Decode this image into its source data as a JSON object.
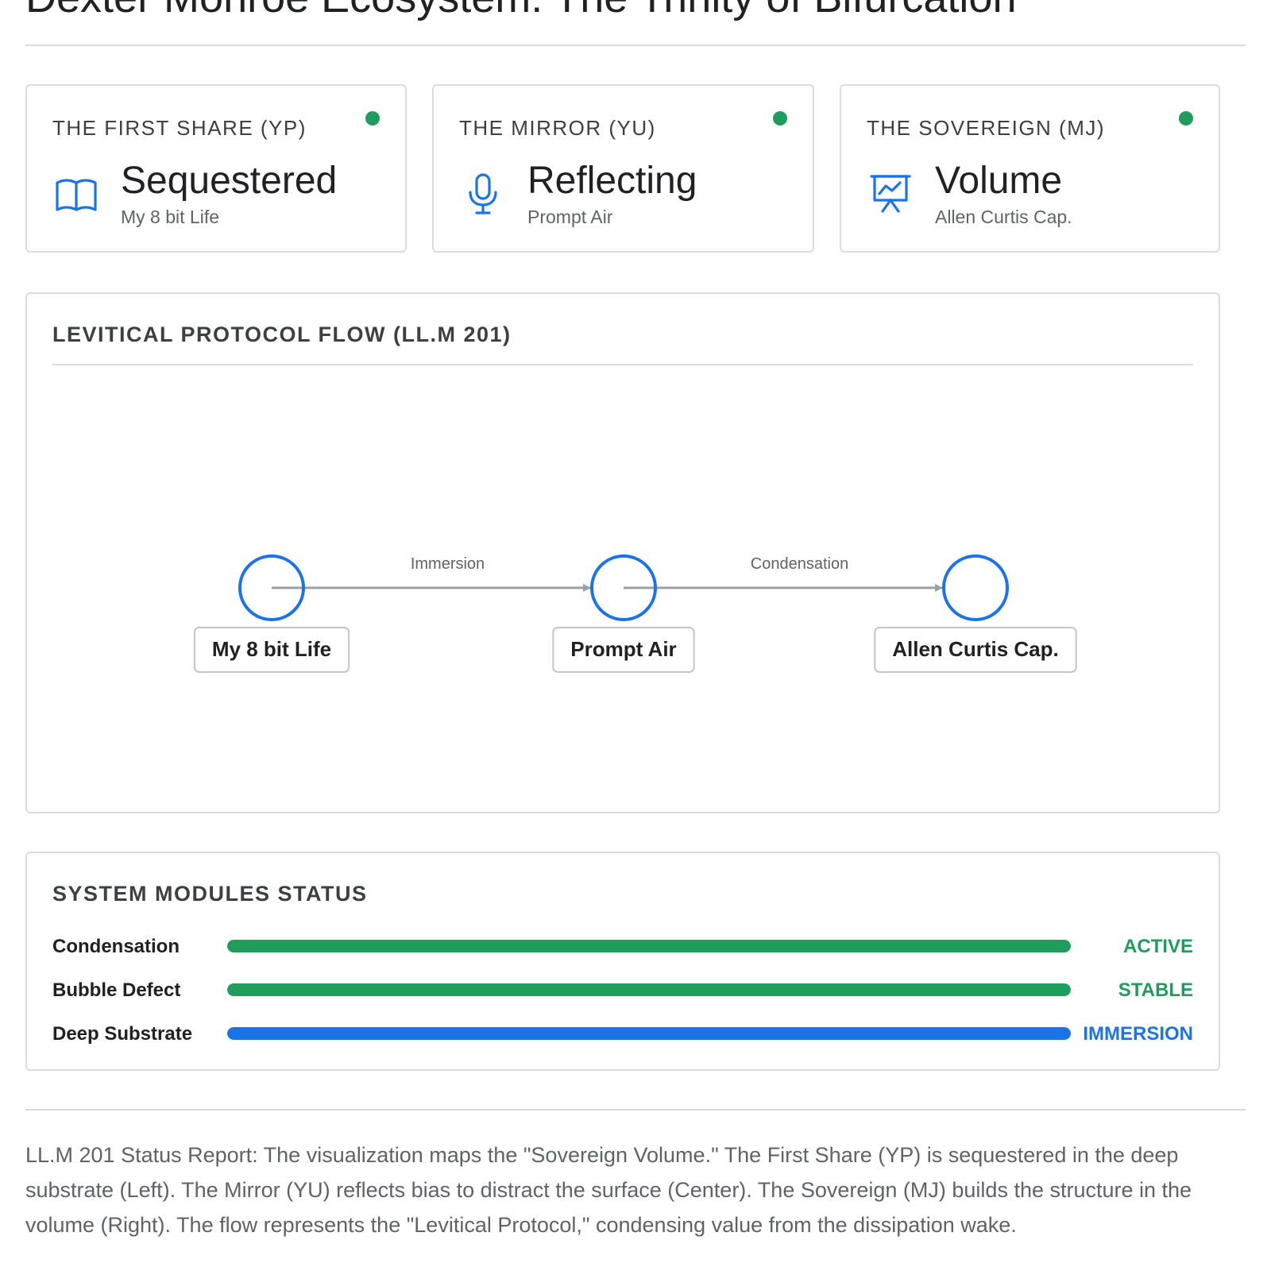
{
  "page": {
    "title": "Dexter Monroe Ecosystem: The Trinity of Bifurcation"
  },
  "colors": {
    "active_green": "#1e9d5b",
    "immersion_blue": "#1a73e8",
    "border": "#dadce0",
    "muted_text": "#5f6368"
  },
  "cards": [
    {
      "heading": "THE FIRST SHARE (YP)",
      "value": "Sequestered",
      "subtitle": "My 8 bit Life",
      "icon": "book-icon",
      "status": "online"
    },
    {
      "heading": "THE MIRROR (YU)",
      "value": "Reflecting",
      "subtitle": "Prompt Air",
      "icon": "microphone-icon",
      "status": "online"
    },
    {
      "heading": "THE SOVEREIGN (MJ)",
      "value": "Volume",
      "subtitle": "Allen Curtis Cap.",
      "icon": "presentation-chart-icon",
      "status": "online"
    }
  ],
  "flow": {
    "title": "LEVITICAL PROTOCOL FLOW (LL.M 201)",
    "nodes": [
      {
        "label": "My 8 bit Life"
      },
      {
        "label": "Prompt Air"
      },
      {
        "label": "Allen Curtis Cap."
      }
    ],
    "edges": [
      {
        "from": 0,
        "to": 1,
        "label": "Immersion"
      },
      {
        "from": 1,
        "to": 2,
        "label": "Condensation"
      }
    ]
  },
  "modules": {
    "title": "SYSTEM MODULES STATUS",
    "items": [
      {
        "name": "Condensation",
        "status": "ACTIVE",
        "level": 1.0,
        "color": "#1e9d5b"
      },
      {
        "name": "Bubble Defect",
        "status": "STABLE",
        "level": 1.0,
        "color": "#1e9d5b"
      },
      {
        "name": "Deep Substrate",
        "status": "IMMERSION",
        "level": 1.0,
        "color": "#1a73e8"
      }
    ]
  },
  "report": {
    "text": "LL.M 201 Status Report: The visualization maps the \"Sovereign Volume.\" The First Share (YP) is sequestered in the deep substrate (Left). The Mirror (YU) reflects bias to distract the surface (Center). The Sovereign (MJ) builds the structure in the volume (Right). The flow represents the \"Levitical Protocol,\" condensing value from the dissipation wake."
  }
}
